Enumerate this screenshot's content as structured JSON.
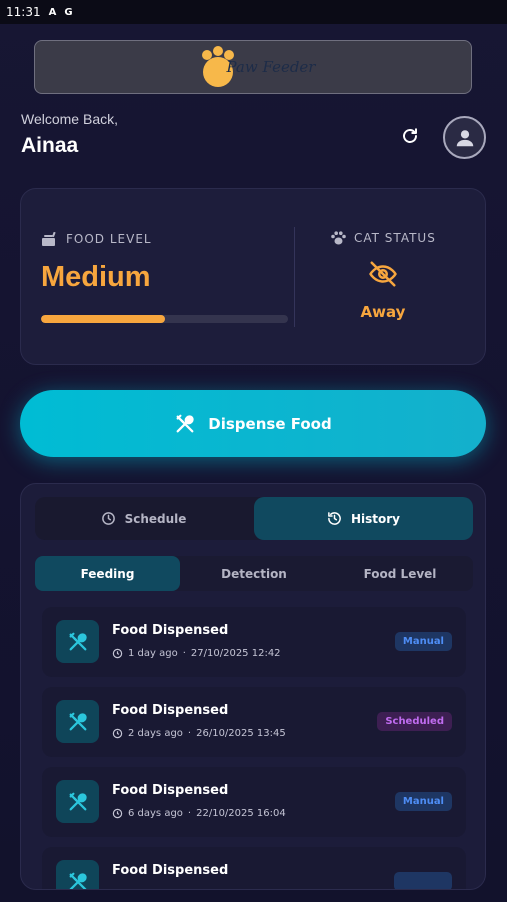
{
  "status_bar": {
    "time": "11:31",
    "icon_a": "A",
    "icon_g": "G"
  },
  "app": {
    "logo_text": "Paw Feeder"
  },
  "header": {
    "welcome": "Welcome Back,",
    "name": "Ainaa"
  },
  "status_card": {
    "food_level_label": "FOOD LEVEL",
    "food_level_value": "Medium",
    "food_level_fraction": 0.5,
    "cat_status_label": "CAT STATUS",
    "cat_status_value": "Away"
  },
  "dispense_button": {
    "label": "Dispense Food"
  },
  "main_tabs": [
    {
      "label": "Schedule",
      "icon": "clock-icon",
      "active": false
    },
    {
      "label": "History",
      "icon": "history-icon",
      "active": true
    }
  ],
  "sub_tabs": [
    {
      "label": "Feeding",
      "active": true
    },
    {
      "label": "Detection",
      "active": false
    },
    {
      "label": "Food Level",
      "active": false
    }
  ],
  "history": [
    {
      "title": "Food Dispensed",
      "ago": "1 day ago",
      "datetime": "27/10/2025 12:42",
      "badge": "Manual"
    },
    {
      "title": "Food Dispensed",
      "ago": "2 days ago",
      "datetime": "26/10/2025 13:45",
      "badge": "Scheduled"
    },
    {
      "title": "Food Dispensed",
      "ago": "6 days ago",
      "datetime": "22/10/2025 16:04",
      "badge": "Manual"
    },
    {
      "title": "Food Dispensed",
      "ago": "",
      "datetime": "",
      "badge": ""
    }
  ],
  "colors": {
    "accent": "#00bcd4",
    "food_level": "#f7a63e",
    "badge_manual": "#4e8df5",
    "badge_scheduled": "#c06cf0",
    "active_tab": "#10495f"
  }
}
